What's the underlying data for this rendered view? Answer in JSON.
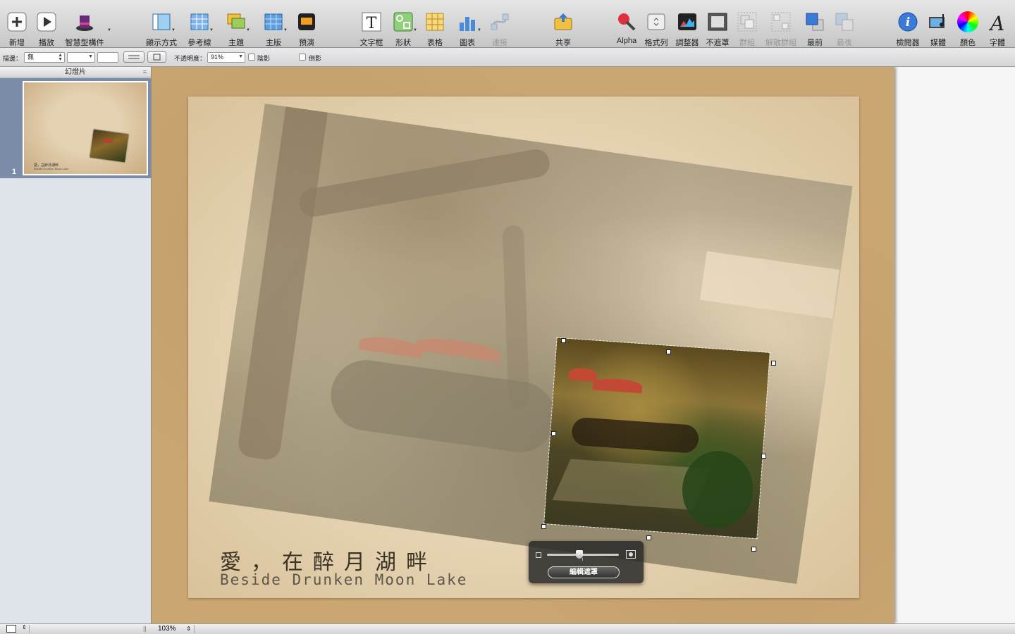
{
  "toolbar": {
    "new": "新增",
    "play": "播放",
    "smart_build": "智慧型構件",
    "view": "顯示方式",
    "guides": "參考線",
    "themes": "主題",
    "masters": "主版",
    "preview": "預演",
    "text_box": "文字框",
    "shapes": "形狀",
    "table": "表格",
    "chart": "圖表",
    "connect": "連接",
    "share": "共享",
    "alpha": "Alpha",
    "format_bar": "格式列",
    "adjust": "調整器",
    "mask": "不遮罩",
    "group": "群組",
    "ungroup": "解散群組",
    "front": "最前",
    "back": "最後",
    "inspector": "檢閱器",
    "media": "媒體",
    "colors": "顏色",
    "fonts": "字體"
  },
  "format_bar": {
    "stroke_label": "描邊：",
    "stroke_value": "無",
    "opacity_label": "不透明度：",
    "opacity_value": "91%",
    "shadow_label": "陰影",
    "reflection_label": "倒影"
  },
  "sidebar": {
    "header": "幻燈片",
    "slides": [
      {
        "number": "1",
        "title_cn": "愛，在醉月湖畔",
        "title_en": "Beside Drunken Moon Lake"
      }
    ]
  },
  "slide": {
    "title_cn": "愛，在醉月湖畔",
    "title_en": "Beside Drunken Moon Lake"
  },
  "mask_hud": {
    "edit_mask": "編輯遮罩",
    "scale_level": 0.45
  },
  "status": {
    "zoom": "103%"
  },
  "colors": {
    "toolbar_bg": "#d2d2d2",
    "sidebar_selected": "#7b8ca9",
    "slide_bg": "#caa673",
    "paper": "#ead9bb"
  }
}
